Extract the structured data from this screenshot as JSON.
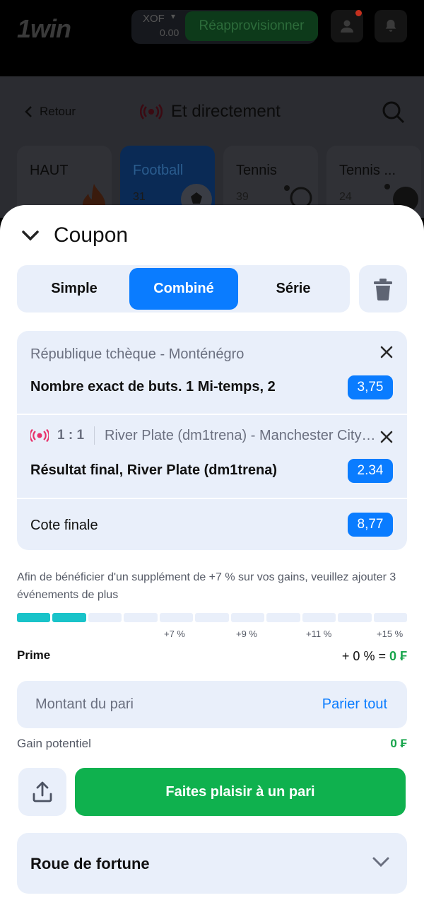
{
  "header": {
    "logo": "1win",
    "currency": "XOF",
    "balance": "0.00",
    "topup_label": "Réapprovisionner"
  },
  "background": {
    "back_label": "Retour",
    "page_title": "Et directement",
    "sports": [
      {
        "label": "HAUT",
        "count": ""
      },
      {
        "label": "Football",
        "count": "31"
      },
      {
        "label": "Tennis",
        "count": "39"
      },
      {
        "label": "Tennis ...",
        "count": "24"
      }
    ]
  },
  "coupon": {
    "title": "Coupon",
    "tabs": [
      "Simple",
      "Combiné",
      "Série"
    ],
    "active_tab": "Combiné",
    "bets": [
      {
        "match": "République tchèque - Monténégro",
        "market": "Nombre exact de buts. 1 Mi-temps, 2",
        "odd": "3,75",
        "live": false
      },
      {
        "live": true,
        "score": "1 : 1",
        "match": "River Plate (dm1trena) - Manchester City (dm1trena)",
        "market": "Résultat final, River Plate (dm1trena)",
        "odd": "2.34"
      }
    ],
    "total_label": "Cote finale",
    "total_odd": "8,77",
    "bonus_info": "Afin de bénéficier d'un supplément de +7 % sur vos gains, veuillez ajouter 3 événements de plus",
    "progress": {
      "segments": 11,
      "filled": 2,
      "labels": [
        "+7 %",
        "+9 %",
        "+11 %",
        "+15 %"
      ]
    },
    "prime_label": "Prime",
    "prime_percent": "+ 0 % = ",
    "prime_amount": "0 ₣",
    "stake_placeholder": "Montant du pari",
    "bet_all_label": "Parier tout",
    "gain_label": "Gain potentiel",
    "gain_value": "0 ₣",
    "place_bet_label": "Faites plaisir à un pari",
    "fortune_label": "Roue de fortune"
  },
  "colors": {
    "accent": "#0a7cff",
    "cta_green": "#0fb14e",
    "progress_fill": "#19c3c9",
    "live_red": "#e8316a"
  }
}
